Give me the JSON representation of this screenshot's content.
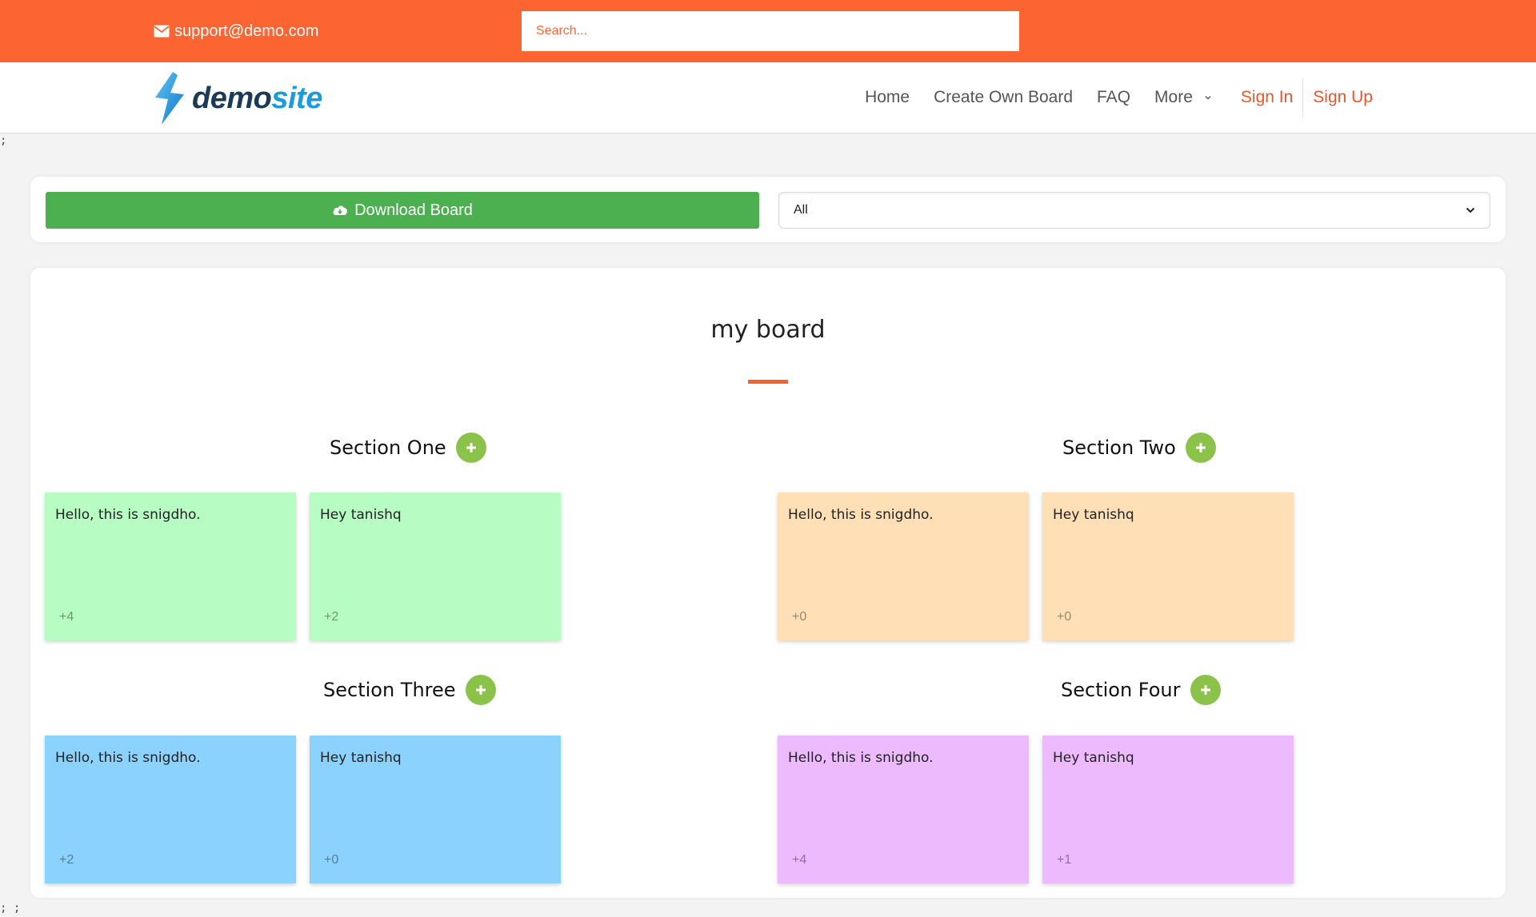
{
  "topbar": {
    "email": "support@demo.com",
    "search_placeholder": "Search...",
    "email_icon": "envelope-icon"
  },
  "brand": {
    "part1": "demo",
    "part2": "site",
    "logo_icon": "lightning-bolt-icon"
  },
  "nav": {
    "home": "Home",
    "create_board": "Create Own Board",
    "faq": "FAQ",
    "more": "More",
    "sign_in": "Sign In",
    "sign_up": "Sign Up"
  },
  "stray": {
    "top": ";",
    "bottom": "; ;"
  },
  "toolbar": {
    "download_label": "Download Board",
    "download_icon": "cloud-download-icon",
    "filter_selected": "All"
  },
  "board": {
    "title": "my board",
    "accent_color": "#f26430",
    "sections": [
      {
        "name": "Section One",
        "color": "#b6fcc3",
        "cards": [
          {
            "text": "Hello, this is snigdho.",
            "votes": "+4"
          },
          {
            "text": "Hey tanishq",
            "votes": "+2"
          }
        ]
      },
      {
        "name": "Section Two",
        "color": "#fedfb6",
        "cards": [
          {
            "text": "Hello, this is snigdho.",
            "votes": "+0"
          },
          {
            "text": "Hey tanishq",
            "votes": "+0"
          }
        ]
      },
      {
        "name": "Section Three",
        "color": "#8bd3fe",
        "cards": [
          {
            "text": "Hello, this is snigdho.",
            "votes": "+2"
          },
          {
            "text": "Hey tanishq",
            "votes": "+0"
          }
        ]
      },
      {
        "name": "Section Four",
        "color": "#edbafd",
        "cards": [
          {
            "text": "Hello, this is snigdho.",
            "votes": "+4"
          },
          {
            "text": "Hey tanishq",
            "votes": "+1"
          }
        ]
      }
    ]
  }
}
